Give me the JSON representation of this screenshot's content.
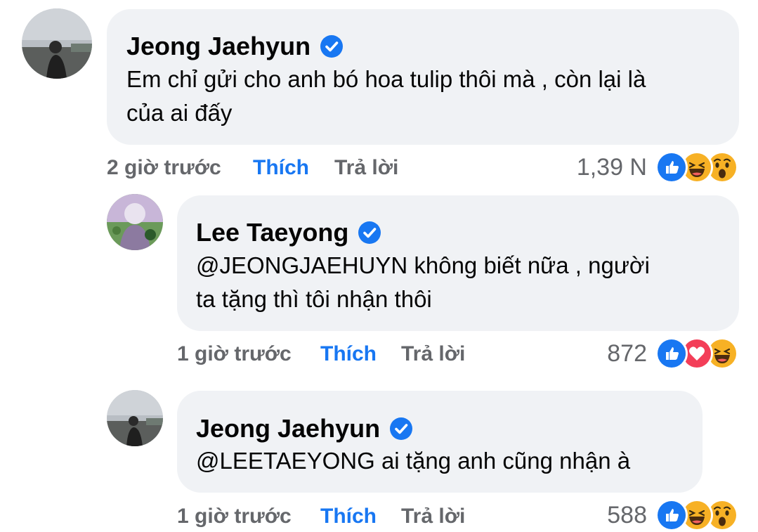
{
  "comments": [
    {
      "author": "Jeong Jaehyun",
      "text_lines": [
        "Em chỉ gửi cho anh bó hoa tulip thôi mà , còn lại là",
        "của ai đấy"
      ],
      "time": "2 giờ trước",
      "like_label": "Thích",
      "reply_label": "Trả lời",
      "reaction_count": "1,39 N",
      "reactions": [
        "like-icon",
        "haha-icon",
        "wow-icon"
      ],
      "avatar": "avatar-jaehyun",
      "verified": true
    },
    {
      "author": "Lee Taeyong",
      "text_lines": [
        "@JEONGJAEHUYN  không biết nữa , người",
        "ta tặng thì tôi nhận thôi"
      ],
      "time": "1 giờ trước",
      "like_label": "Thích",
      "reply_label": "Trả lời",
      "reaction_count": "872",
      "reactions": [
        "like-icon",
        "love-icon",
        "haha-icon"
      ],
      "avatar": "avatar-taeyong",
      "verified": true
    },
    {
      "author": "Jeong Jaehyun",
      "text_lines": [
        "@LEETAEYONG ai tặng anh cũng nhận à"
      ],
      "time": "1 giờ trước",
      "like_label": "Thích",
      "reply_label": "Trả lời",
      "reaction_count": "588",
      "reactions": [
        "like-icon",
        "haha-icon",
        "wow-icon"
      ],
      "avatar": "avatar-jaehyun",
      "verified": true
    }
  ],
  "colors": {
    "bubble": "#f0f2f5",
    "like_blue": "#1877f2",
    "meta_gray": "#65676b",
    "love_red": "#f33e58",
    "reaction_yellow": "#f7b125"
  }
}
